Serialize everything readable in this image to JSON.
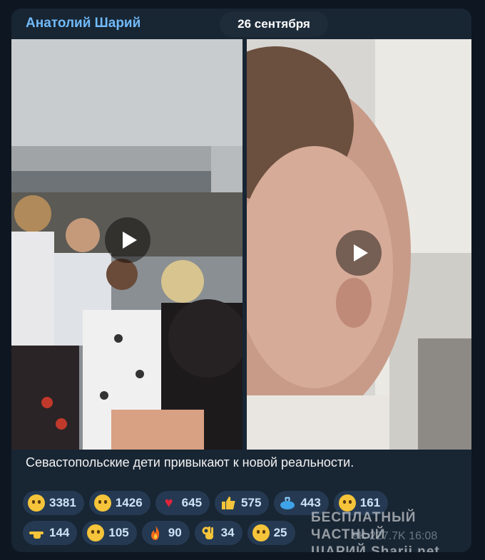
{
  "header": {
    "channel_name": "Анатолий Шарий",
    "date": "26 сентября"
  },
  "message": {
    "caption": "Севастопольские дети привыкают к новой реальности.",
    "meta": "9K 227.7K 16:08"
  },
  "reactions": {
    "row1": [
      {
        "icon": "crying-face-icon",
        "count": "3381"
      },
      {
        "icon": "grinning-face-icon",
        "count": "1426"
      },
      {
        "icon": "red-heart-icon",
        "count": "645"
      },
      {
        "icon": "thumbs-up-icon",
        "count": "575"
      },
      {
        "icon": "whale-icon",
        "count": "443"
      },
      {
        "icon": "exploding-head-icon",
        "count": "161"
      }
    ],
    "row2": [
      {
        "icon": "pointing-hand-icon",
        "count": "144"
      },
      {
        "icon": "screaming-face-icon",
        "count": "105"
      },
      {
        "icon": "fire-icon",
        "count": "90"
      },
      {
        "icon": "ok-hand-icon",
        "count": "34"
      },
      {
        "icon": "smiling-hearts-face-icon",
        "count": "25"
      }
    ]
  },
  "watermark": {
    "line1": "БЕСПЛАТНЫЙ ЧАСТНЫЙ",
    "line2": "ШАРИЙ Sharij.net"
  },
  "colors": {
    "background": "#0e1621",
    "bubble": "#182533",
    "accent": "#71baf9",
    "reaction_bg": "#253a52"
  }
}
